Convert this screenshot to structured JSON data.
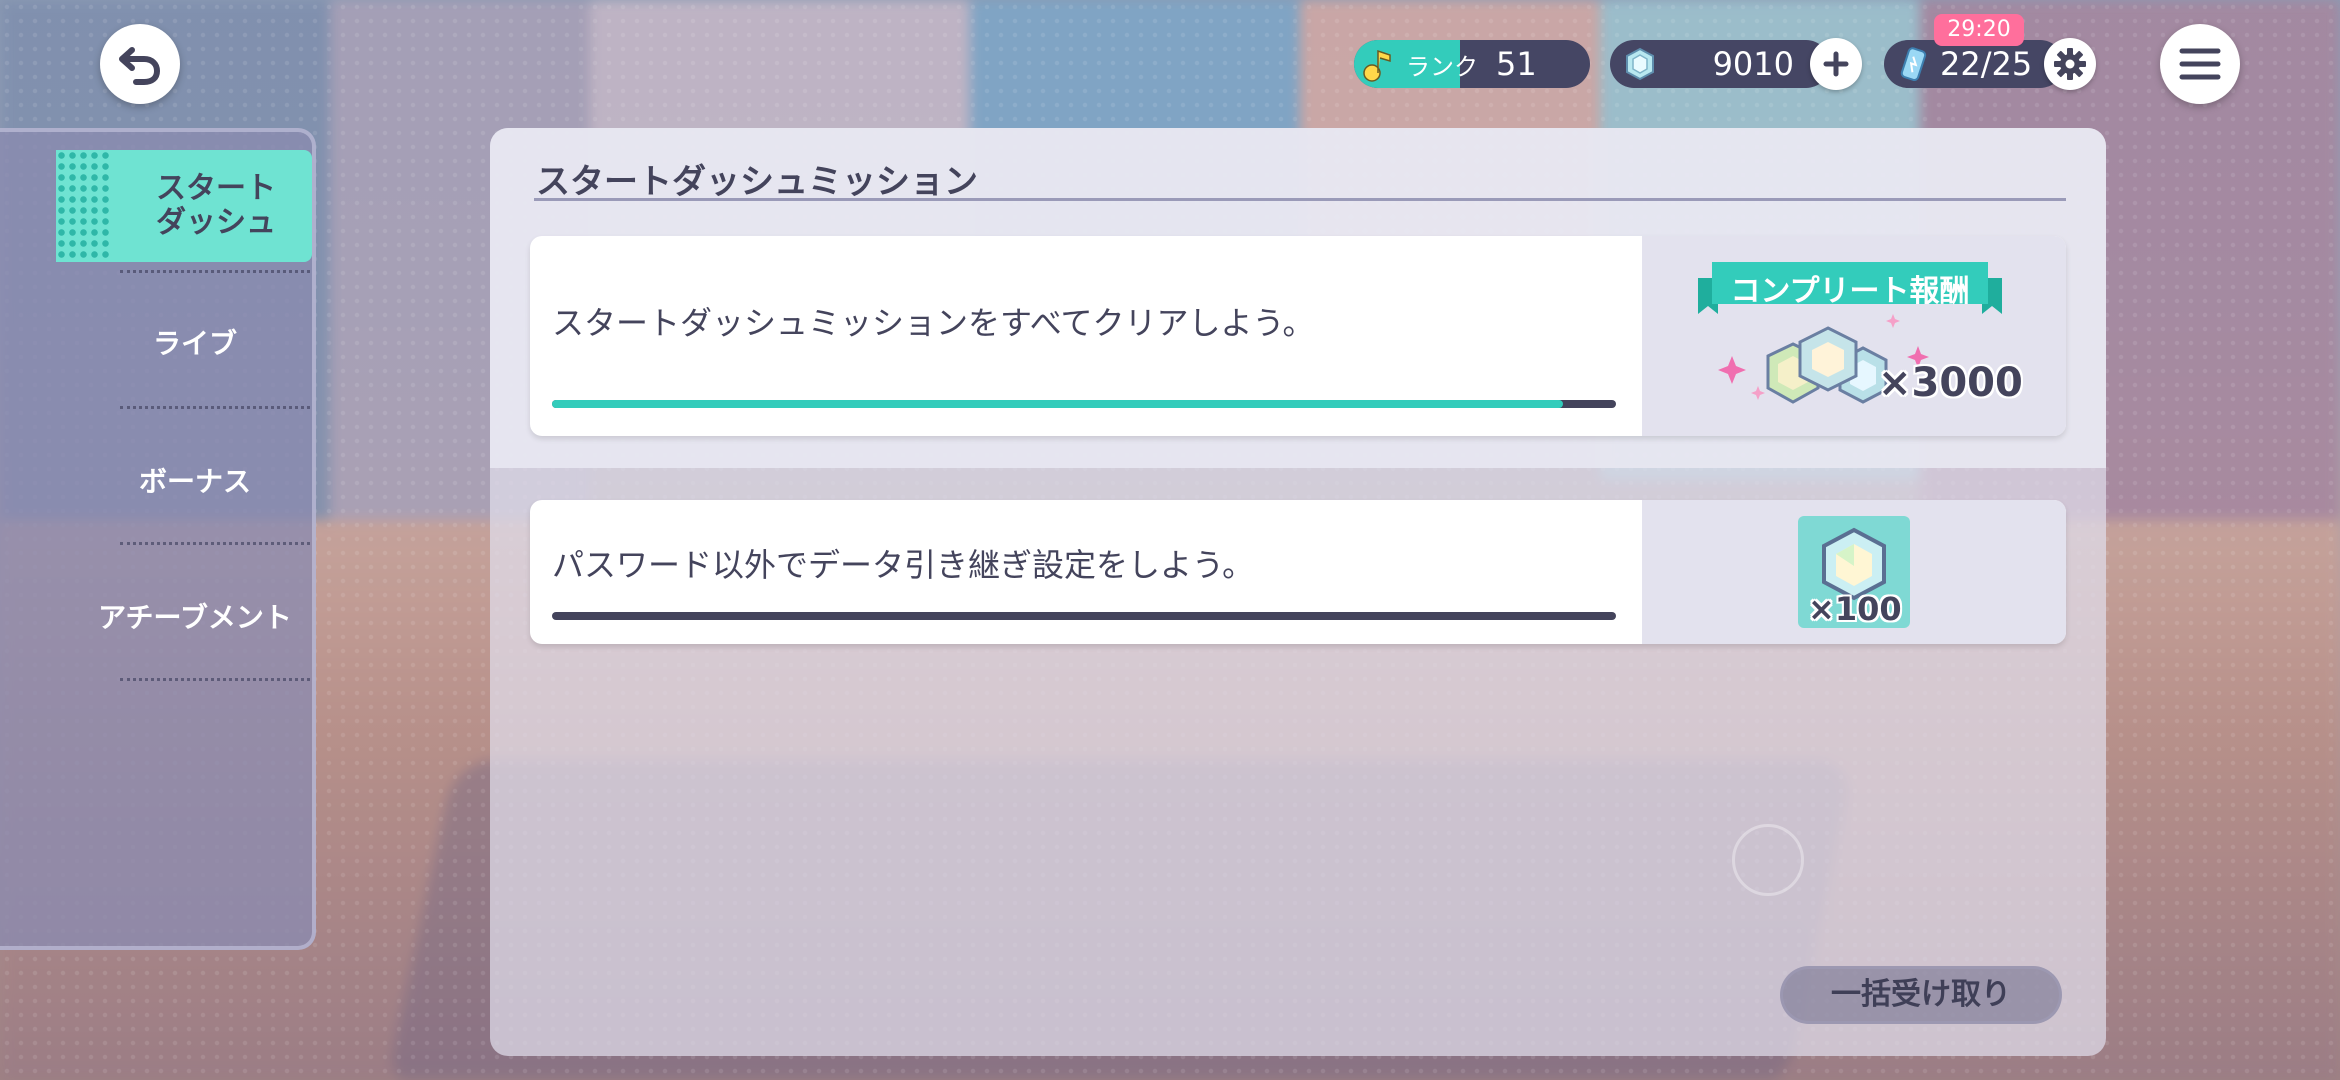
{
  "header": {
    "rank_label": "ランク",
    "rank_value": "51",
    "rank_progress": 0.45,
    "gems_value": "9010",
    "energy_value": "22/25",
    "energy_timer": "29:20"
  },
  "sidebar": {
    "items": [
      {
        "label": "スタート\nダッシュ",
        "active": true
      },
      {
        "label": "ライブ",
        "active": false
      },
      {
        "label": "ボーナス",
        "active": false
      },
      {
        "label": "アチーブメント",
        "active": false
      }
    ]
  },
  "main": {
    "title": "スタートダッシュミッション",
    "missions": [
      {
        "text": "スタートダッシュミッションをすべてクリアしよう。",
        "progress": 0.95,
        "reward_ribbon": "コンプリート報酬",
        "reward_qty": "×3000"
      },
      {
        "text": "パスワード以外でデータ引き継ぎ設定をしよう。",
        "progress": 0.0,
        "reward_qty": "×100"
      }
    ],
    "claim_all_label": "一括受け取り"
  },
  "colors": {
    "accent": "#33ccbb",
    "dark": "#44445c",
    "badge": "#ff6f9c"
  },
  "icons": [
    "back-arrow-icon",
    "music-note-icon",
    "gem-icon",
    "plus-icon",
    "energy-can-icon",
    "gear-icon",
    "hamburger-menu-icon",
    "crystal-reward-icon"
  ]
}
